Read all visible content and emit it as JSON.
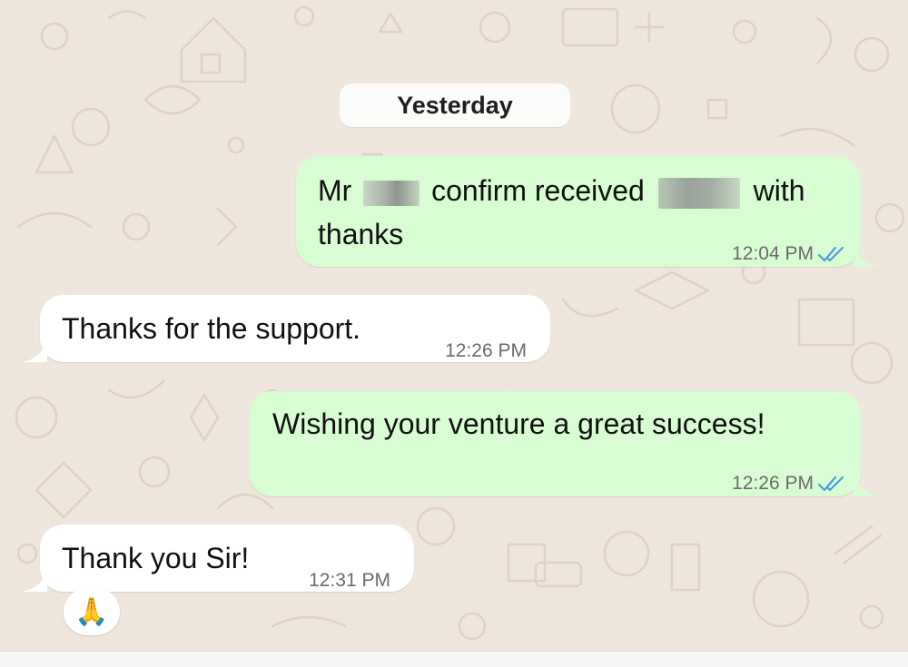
{
  "date_separator": "Yesterday",
  "messages": [
    {
      "direction": "outgoing",
      "line1_a": "Mr",
      "line1_b": "confirm received",
      "line1_c": "with",
      "line2": "thanks",
      "time": "12:04 PM",
      "status": "read"
    },
    {
      "direction": "incoming",
      "text": "Thanks for the support.",
      "time": "12:26 PM"
    },
    {
      "direction": "outgoing",
      "text": "Wishing your venture a great success!",
      "time": "12:26 PM",
      "status": "read"
    },
    {
      "direction": "incoming",
      "text": "Thank you Sir!",
      "time": "12:31 PM",
      "reaction": "🙏"
    }
  ],
  "colors": {
    "outgoing_bubble": "#d9fdd3",
    "incoming_bubble": "#ffffff",
    "read_ticks": "#4a9fe0",
    "wallpaper": "#efe7dd"
  },
  "icons": {
    "read_receipt": "double-check-icon"
  }
}
